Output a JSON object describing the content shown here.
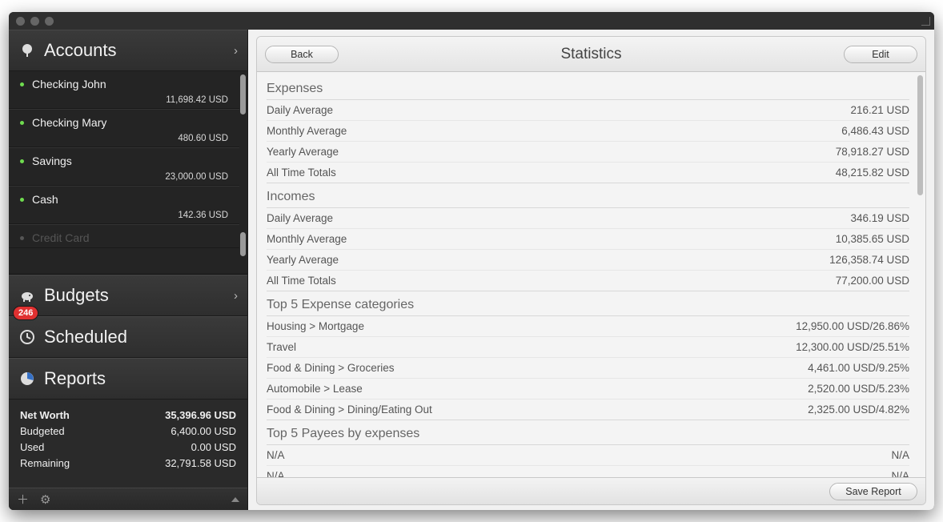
{
  "sidebar": {
    "accounts_header": "Accounts",
    "accounts": [
      {
        "name": "Checking John",
        "balance": "11,698.42 USD"
      },
      {
        "name": "Checking Mary",
        "balance": "480.60 USD"
      },
      {
        "name": "Savings",
        "balance": "23,000.00 USD"
      },
      {
        "name": "Cash",
        "balance": "142.36 USD"
      },
      {
        "name": "Credit Card",
        "balance": ""
      }
    ],
    "budgets_header": "Budgets",
    "scheduled_header": "Scheduled",
    "scheduled_badge": "246",
    "reports_header": "Reports",
    "summary": {
      "net_worth_label": "Net Worth",
      "net_worth_value": "35,396.96 USD",
      "budgeted_label": "Budgeted",
      "budgeted_value": "6,400.00 USD",
      "used_label": "Used",
      "used_value": "0.00 USD",
      "remaining_label": "Remaining",
      "remaining_value": "32,791.58 USD"
    }
  },
  "toolbar": {
    "back_label": "Back",
    "title": "Statistics",
    "edit_label": "Edit"
  },
  "stats": {
    "expenses_title": "Expenses",
    "expenses": [
      {
        "label": "Daily Average",
        "value": "216.21 USD"
      },
      {
        "label": "Monthly Average",
        "value": "6,486.43 USD"
      },
      {
        "label": "Yearly Average",
        "value": "78,918.27 USD"
      },
      {
        "label": "All Time Totals",
        "value": "48,215.82 USD"
      }
    ],
    "incomes_title": "Incomes",
    "incomes": [
      {
        "label": "Daily Average",
        "value": "346.19 USD"
      },
      {
        "label": "Monthly Average",
        "value": "10,385.65 USD"
      },
      {
        "label": "Yearly Average",
        "value": "126,358.74 USD"
      },
      {
        "label": "All Time Totals",
        "value": "77,200.00 USD"
      }
    ],
    "top_expense_cat_title": "Top 5 Expense categories",
    "top_expense_cat": [
      {
        "label": "Housing > Mortgage",
        "value": "12,950.00 USD/26.86%"
      },
      {
        "label": "Travel",
        "value": "12,300.00 USD/25.51%"
      },
      {
        "label": "Food & Dining > Groceries",
        "value": "4,461.00 USD/9.25%"
      },
      {
        "label": "Automobile > Lease",
        "value": "2,520.00 USD/5.23%"
      },
      {
        "label": "Food & Dining > Dining/Eating Out",
        "value": "2,325.00 USD/4.82%"
      }
    ],
    "top_payees_title": "Top 5 Payees by expenses",
    "top_payees": [
      {
        "label": "N/A",
        "value": "N/A"
      },
      {
        "label": "N/A",
        "value": "N/A"
      }
    ]
  },
  "footer": {
    "save_report_label": "Save Report"
  }
}
